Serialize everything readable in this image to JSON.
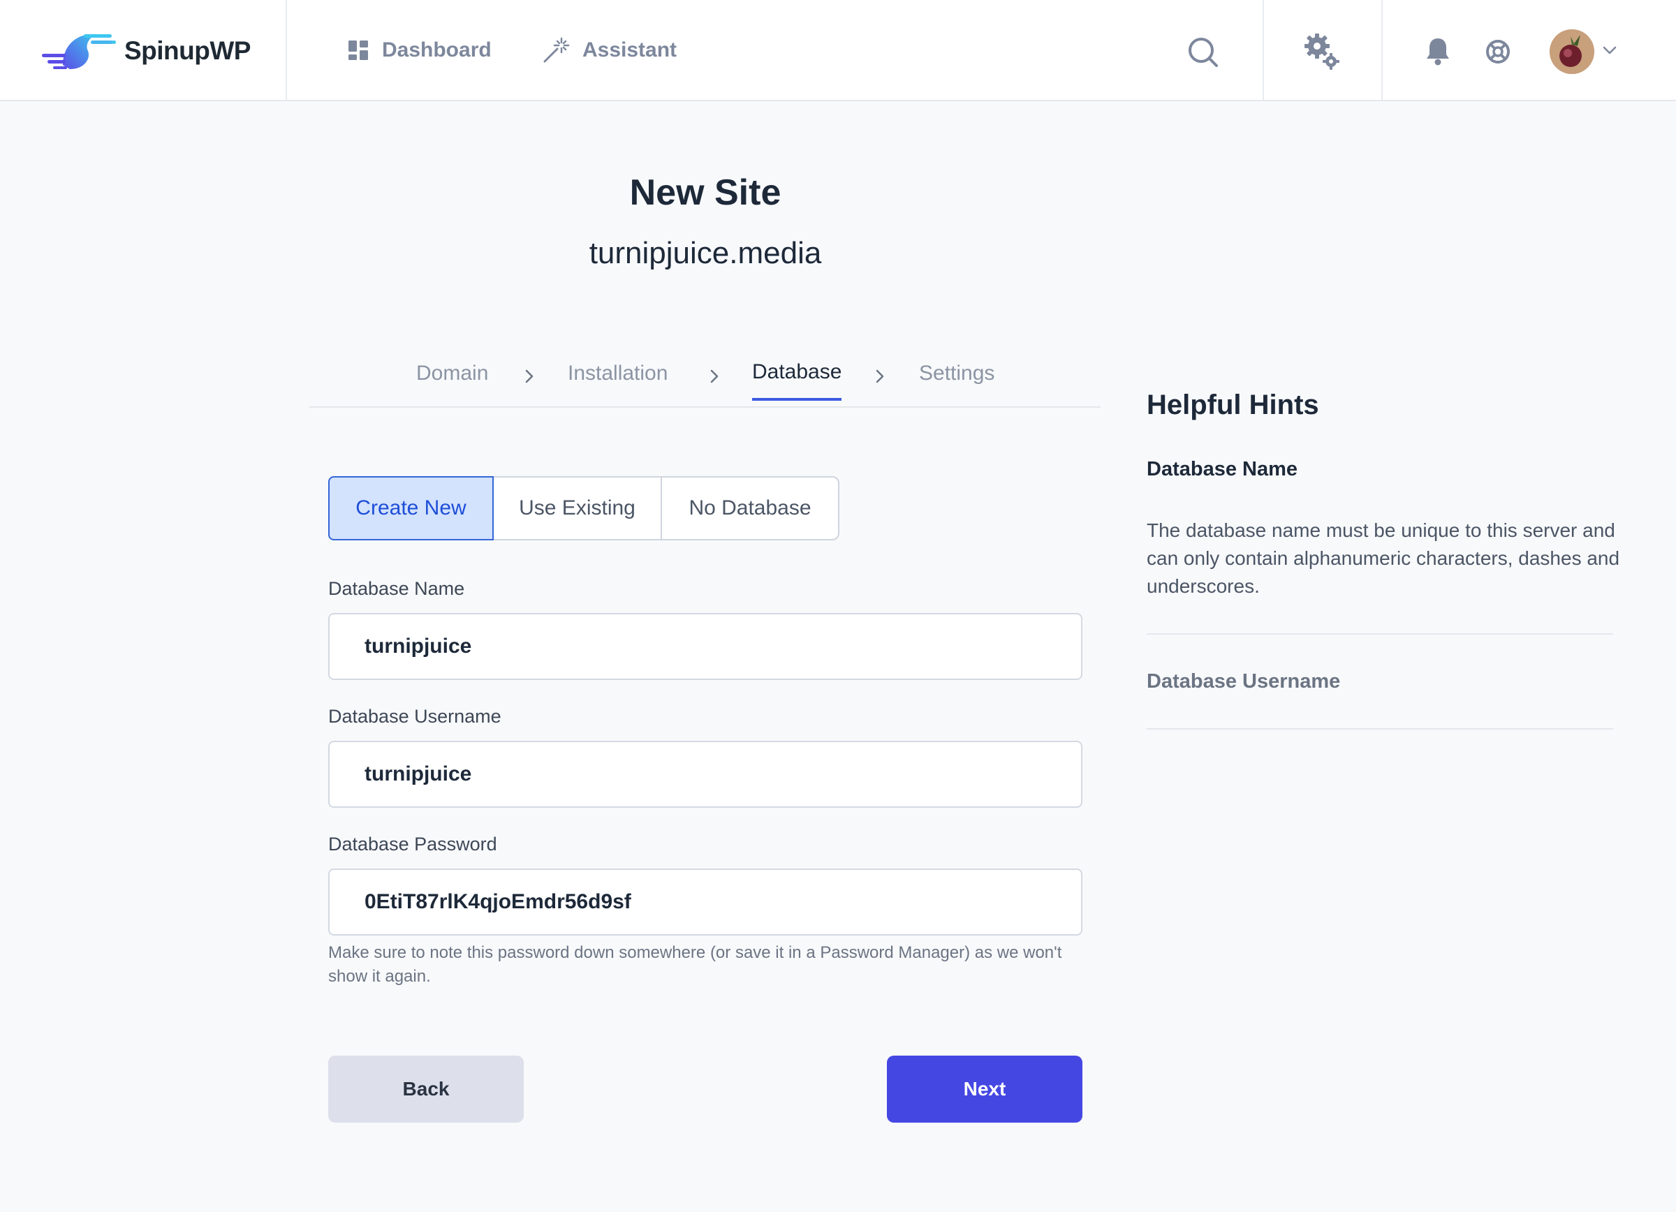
{
  "app": {
    "brand_name": "SpinupWP",
    "accent_color": "#4547e3"
  },
  "nav": {
    "dashboard_label": "Dashboard",
    "assistant_label": "Assistant"
  },
  "toolbar_icons": [
    "search-icon",
    "gear-icon",
    "bell-icon",
    "help-icon",
    "avatar",
    "chevron-down-icon"
  ],
  "header": {
    "title": "New Site",
    "subtitle": "turnipjuice.media"
  },
  "stepper": {
    "steps": [
      "Domain",
      "Installation",
      "Database",
      "Settings"
    ],
    "active": "Database"
  },
  "database_mode": {
    "options": [
      "Create New",
      "Use Existing",
      "No Database"
    ],
    "selected": "Create New"
  },
  "form": {
    "db_name_label": "Database Name",
    "db_name_value": "turnipjuice",
    "db_user_label": "Database Username",
    "db_user_value": "turnipjuice",
    "db_pass_label": "Database Password",
    "db_pass_value": "0EtiT87rlK4qjoEmdr56d9sf",
    "password_help": "Make sure to note this password down somewhere (or save it in a Password Manager) as we won't show it again."
  },
  "actions": {
    "back_label": "Back",
    "next_label": "Next"
  },
  "hints": {
    "title": "Helpful Hints",
    "items": [
      {
        "heading": "Database Name",
        "body": "The database name must be unique to this server and can only contain alphanumeric characters, dashes and underscores."
      },
      {
        "heading": "Database Username"
      }
    ]
  }
}
